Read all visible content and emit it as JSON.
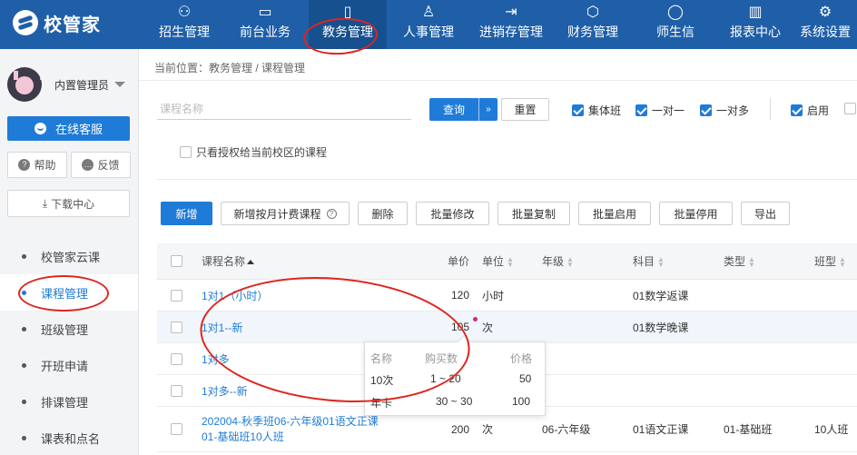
{
  "app": {
    "logo_text": "校管家"
  },
  "nav": {
    "items": [
      {
        "label": "招生管理",
        "icon": "person-add-icon",
        "glyph": "⚇"
      },
      {
        "label": "前台业务",
        "icon": "monitor-icon",
        "glyph": "▭"
      },
      {
        "label": "教务管理",
        "icon": "book-icon",
        "glyph": "▯",
        "active": true
      },
      {
        "label": "人事管理",
        "icon": "user-icon",
        "glyph": "♙"
      },
      {
        "label": "进销存管理",
        "icon": "inventory-icon",
        "glyph": "⇥"
      },
      {
        "label": "财务管理",
        "icon": "finance-icon",
        "glyph": "⬡"
      },
      {
        "label": "师生信",
        "icon": "chat-icon",
        "glyph": "◯"
      },
      {
        "label": "报表中心",
        "icon": "report-icon",
        "glyph": "▥"
      },
      {
        "label": "系统设置",
        "icon": "settings-icon",
        "glyph": "⚙"
      }
    ]
  },
  "sidebar": {
    "user_name": "内置管理员",
    "online_service": "在线客服",
    "help": "帮助",
    "feedback": "反馈",
    "download_center": "下载中心",
    "menu": [
      {
        "label": "校管家云课"
      },
      {
        "label": "课程管理",
        "active": true
      },
      {
        "label": "班级管理"
      },
      {
        "label": "开班申请"
      },
      {
        "label": "排课管理"
      },
      {
        "label": "课表和点名"
      }
    ]
  },
  "breadcrumb": "当前位置：教务管理 / 课程管理",
  "search": {
    "placeholder": "课程名称",
    "value": "",
    "query_label": "查询",
    "reset_label": "重置"
  },
  "filters": [
    {
      "label": "集体班",
      "checked": true
    },
    {
      "label": "一对一",
      "checked": true
    },
    {
      "label": "一对多",
      "checked": true
    },
    {
      "label": "启用",
      "checked": true
    }
  ],
  "only_authorized": {
    "label": "只看授权给当前校区的课程",
    "checked": false
  },
  "toolbar": {
    "add": "新增",
    "add_monthly": "新增按月计费课程",
    "delete": "删除",
    "batch_edit": "批量修改",
    "batch_copy": "批量复制",
    "batch_enable": "批量启用",
    "batch_disable": "批量停用",
    "export": "导出"
  },
  "table": {
    "headers": {
      "name": "课程名称",
      "price": "单价",
      "unit": "单位",
      "grade": "年级",
      "subject": "科目",
      "type": "类型",
      "class_type": "班型"
    },
    "rows": [
      {
        "name": "1对1（小时）",
        "price": "120",
        "unit": "小时",
        "grade": "",
        "subject": "01数学返课",
        "type": "",
        "class_type": ""
      },
      {
        "name": "1对1--新",
        "price": "105",
        "unit": "次",
        "grade": "",
        "subject": "01数学晚课",
        "type": "",
        "class_type": ""
      },
      {
        "name": "1对多",
        "price": "",
        "unit": "",
        "grade": "",
        "subject": "",
        "type": "",
        "class_type": ""
      },
      {
        "name": "1对多--新",
        "price": "",
        "unit": "",
        "grade": "",
        "subject": "",
        "type": "",
        "class_type": ""
      },
      {
        "name_line1": "202004-秋季班06-六年级01语文正课",
        "name_line2": "01-基础班10人班",
        "price": "200",
        "unit": "次",
        "grade": "06-六年级",
        "subject": "01语文正课",
        "type": "01-基础班",
        "class_type": "10人班"
      }
    ]
  },
  "price_popover": {
    "headers": {
      "name": "名称",
      "qty": "购买数",
      "price": "价格"
    },
    "rows": [
      {
        "name": "10次",
        "qty": "1 ~ 20",
        "price": "50"
      },
      {
        "name": "年卡",
        "qty": "30 ~ 30",
        "price": "100"
      }
    ]
  },
  "colors": {
    "nav_bg": "#1f5fa8",
    "nav_active_bg": "#17508f",
    "primary": "#1f7bd8",
    "annotation_red": "#e0241d"
  }
}
